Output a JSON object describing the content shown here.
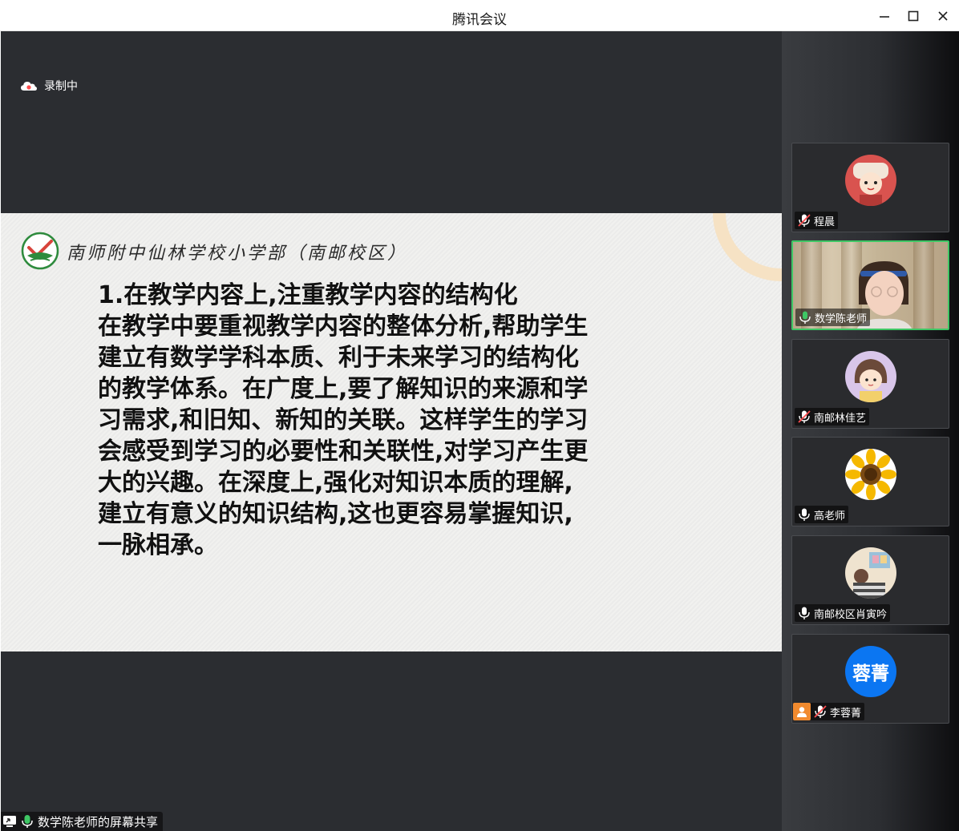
{
  "window": {
    "title": "腾讯会议"
  },
  "recording": {
    "label": "录制中"
  },
  "slide": {
    "school_name": "南师附中仙林学校小学部（南邮校区）",
    "lines": [
      "1.在教学内容上,注重教学内容的结构化",
      "在教学中要重视教学内容的整体分析,帮助学生",
      "建立有数学学科本质、利于未来学习的结构化",
      "的教学体系。在广度上,要了解知识的来源和学",
      "习需求,和旧知、新知的关联。这样学生的学习",
      "会感受到学习的必要性和关联性,对学习产生更",
      "大的兴趣。在深度上,强化对知识本质的理解,",
      "建立有意义的知识结构,这也更容易掌握知识,",
      "一脉相承。"
    ]
  },
  "share": {
    "label": "数学陈老师的屏幕共享"
  },
  "participants": [
    {
      "name": "程晨",
      "muted": true
    },
    {
      "name": "数学陈老师",
      "muted": false,
      "speaking": true
    },
    {
      "name": "南邮林佳艺",
      "muted": true
    },
    {
      "name": "高老师",
      "muted": false
    },
    {
      "name": "南邮校区肖寅吟",
      "muted": false
    },
    {
      "name": "李蓉菁",
      "muted": true,
      "initials": "蓉菁"
    }
  ],
  "colors": {
    "accent_green": "#3fc765",
    "avatar_blue": "#0b76f2",
    "badge_orange": "#f18a2e"
  }
}
